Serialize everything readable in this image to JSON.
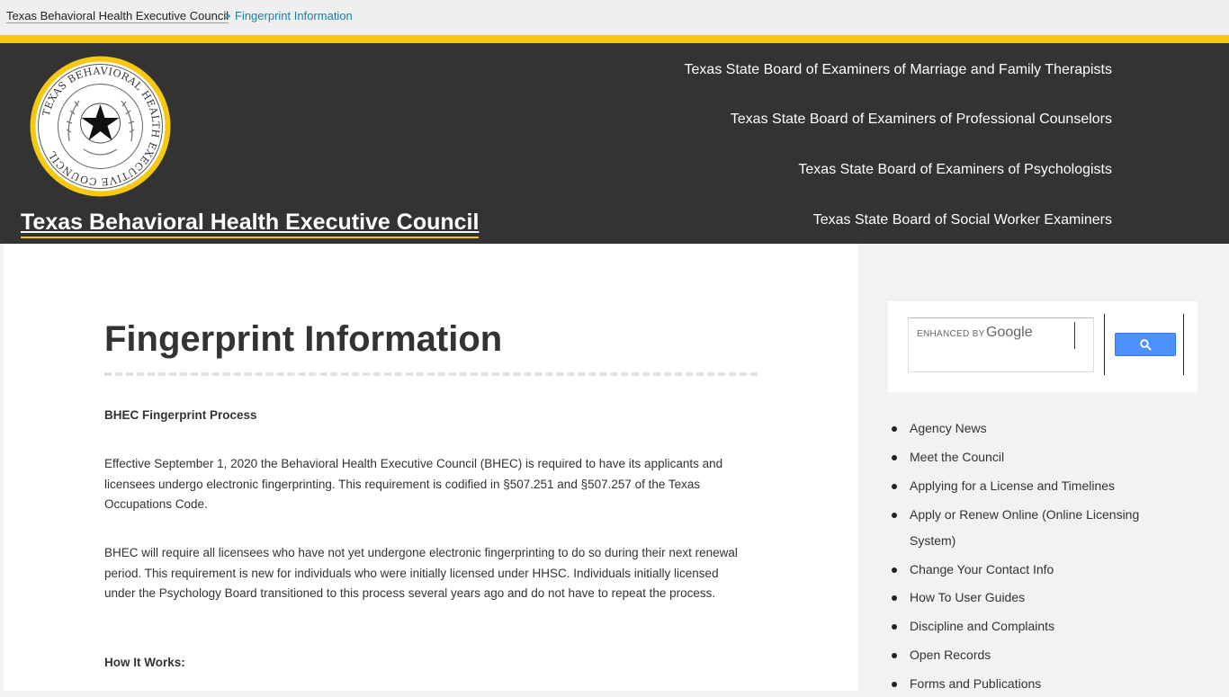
{
  "breadcrumb": {
    "home": "Texas Behavioral Health Executive Council",
    "separator": ">",
    "current": "Fingerprint Information"
  },
  "header": {
    "site_title": "Texas Behavioral Health Executive Council",
    "seal_icon": "texas-state-seal-icon",
    "seal_text": "TEXAS BEHAVIORAL HEALTH EXECUTIVE COUNCIL",
    "boards": [
      "Texas State Board of Examiners of Marriage and Family Therapists",
      "Texas State Board of Examiners of Professional Counselors",
      "Texas State Board of Examiners of Psychologists",
      "Texas State Board of Social Worker Examiners"
    ]
  },
  "main": {
    "title": "Fingerprint Information",
    "heading1": "BHEC Fingerprint Process",
    "para1": "Effective September 1, 2020 the Behavioral Health Executive Council (BHEC) is required to have its applicants and licensees undergo electronic fingerprinting.  This requirement is codified in §507.251 and §507.257 of the Texas Occupations Code.",
    "para2": "BHEC will require all licensees who have not yet undergone electronic fingerprinting to do so during their next renewal period.  This requirement is new for individuals who were initially licensed under HHSC.  Individuals initially licensed under the Psychology Board transitioned to this process several years ago and do not have to repeat the process.",
    "heading2": "How It Works:"
  },
  "search": {
    "enhanced_by": "ENHANCED BY",
    "google": "Google",
    "button_icon": "search-icon"
  },
  "sidebar": {
    "items": [
      "Agency News",
      "Meet the Council",
      "Applying for a License and Timelines",
      "Apply or Renew Online (Online Licensing System)",
      "Change Your Contact Info",
      "How To User Guides",
      "Discipline and Complaints",
      "Open Records",
      "Forms and Publications"
    ]
  },
  "colors": {
    "header_bg": "#333333",
    "accent_gold": "#f6c80f",
    "link_blue": "#1a7fa8",
    "search_button": "#4d90fe"
  }
}
